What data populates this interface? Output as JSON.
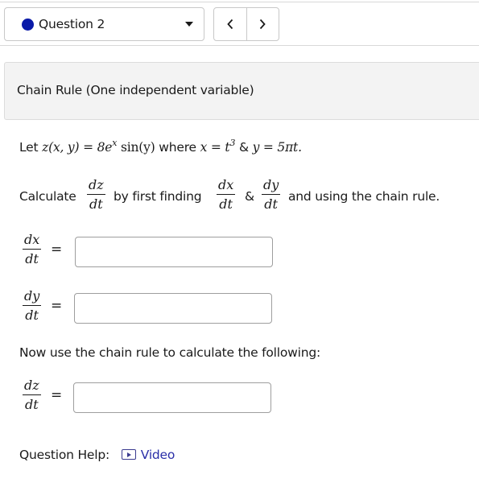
{
  "header": {
    "question_label": "Question 2",
    "question_dot_color": "#0a1aa8",
    "prev_icon": "chevron-left-icon",
    "next_icon": "chevron-right-icon"
  },
  "title": "Chain Rule (One independent variable)",
  "problem": {
    "let": "Let",
    "func": "z(x, y)",
    "equals": "=",
    "expr_coef": "8e",
    "expr_exp": "x",
    "expr_rest": " sin(y)",
    "where": "where",
    "x_eq": "x = t",
    "x_exp": "3",
    "amp": "&",
    "y_eq": "y = 5πt."
  },
  "instruction": {
    "calculate": "Calculate",
    "by_first_finding": "by first finding",
    "amp": "&",
    "and_using": "and using the chain rule."
  },
  "fractions": {
    "dz_num": "dz",
    "dx_num": "dx",
    "dy_num": "dy",
    "dt_den": "dt"
  },
  "answers": {
    "dx_dt_value": "",
    "dy_dt_value": "",
    "dz_dt_value": ""
  },
  "chain_rule_prompt": "Now use the chain rule to calculate the following:",
  "help": {
    "label": "Question Help:",
    "video_label": "Video",
    "video_icon": "play-video-icon"
  }
}
